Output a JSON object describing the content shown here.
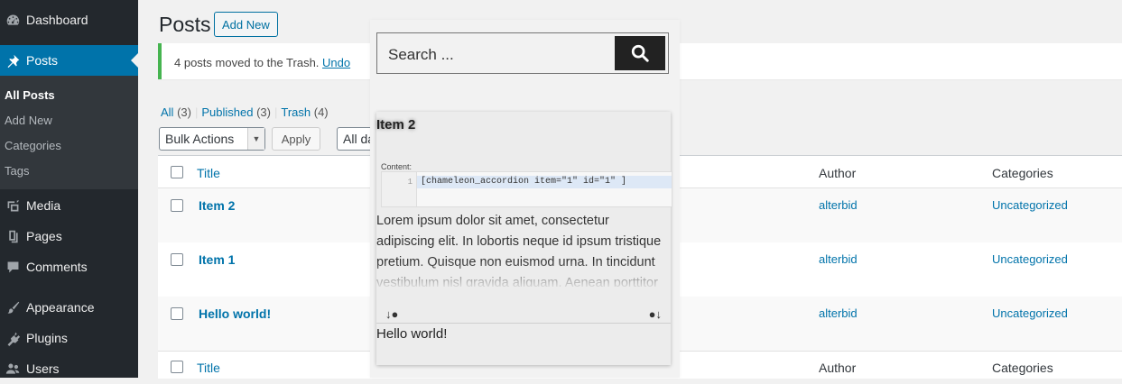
{
  "sidebar": {
    "dashboard": "Dashboard",
    "posts": "Posts",
    "submenu": [
      "All Posts",
      "Add New",
      "Categories",
      "Tags"
    ],
    "media": "Media",
    "pages": "Pages",
    "comments": "Comments",
    "appearance": "Appearance",
    "plugins": "Plugins",
    "users": "Users"
  },
  "header": {
    "title": "Posts",
    "add_new": "Add New"
  },
  "notice": {
    "message": "4 posts moved to the Trash.",
    "undo": "Undo"
  },
  "filters": {
    "all": "All",
    "all_count": "(3)",
    "published": "Published",
    "published_count": "(3)",
    "trash": "Trash",
    "trash_count": "(4)",
    "sep": "|"
  },
  "bulk": {
    "bulk_actions": "Bulk Actions",
    "apply": "Apply",
    "all_dates": "All da"
  },
  "table": {
    "col_title": "Title",
    "col_author": "Author",
    "col_categories": "Categories",
    "rows": [
      {
        "title": "Item 2",
        "author": "alterbid",
        "category": "Uncategorized"
      },
      {
        "title": "Item 1",
        "author": "alterbid",
        "category": "Uncategorized"
      },
      {
        "title": "Hello world!",
        "author": "alterbid",
        "category": "Uncategorized"
      }
    ]
  },
  "overlay": {
    "search_placeholder": "Search ...",
    "card_title": "Item 2",
    "content_label": "Content:",
    "line_number": "1",
    "code": "[chameleon_accordion item=\"1\" id=\"1\" ]",
    "paragraph": "Lorem ipsum dolor sit amet, consectetur adipiscing elit. In lobortis neque id ipsum tristique pretium. Quisque non euismod urna. In tincidunt vestibulum nisl gravida aliquam. Aenean porttitor",
    "arrow_left": "↓●",
    "arrow_right": "●↓",
    "next_title": "Hello world!"
  }
}
